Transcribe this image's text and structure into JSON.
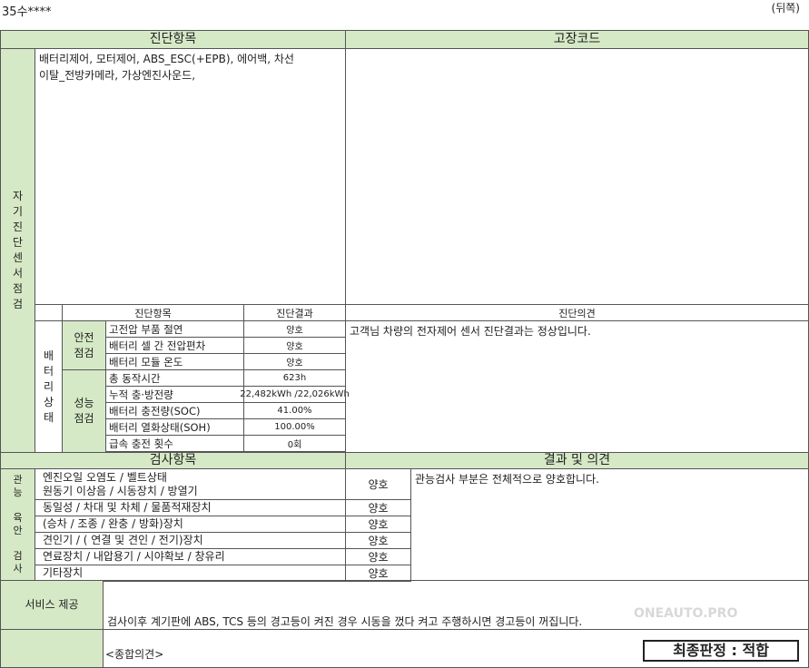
{
  "header": {
    "model": "35수****",
    "page_side": "(뒤쪽)"
  },
  "self_diag": {
    "items_header": "진단항목",
    "codes_header": "고장코드",
    "side_label": "자\n기\n진\n단\n센\n서\n점\n검",
    "items_text": "배터리제어, 모터제어, ABS_ESC(+EPB), 에어백, 차선\n이탈_전방카메라, 가상엔진사운드,",
    "codes_text": ""
  },
  "battery": {
    "side_label": "배\n터\n리\n상\n태",
    "col_item": "진단항목",
    "col_result": "진단결과",
    "col_opinion": "진단의견",
    "opinion": "고객님 차량의 전자제어 센서 진단결과는 정상입니다.",
    "safety_group": "안전\n점검",
    "performance_group": "성능\n점검",
    "rows": [
      {
        "label": "고전압 부품 절연",
        "value": "양호"
      },
      {
        "label": "배터리 셀 간 전압편차",
        "value": "양호"
      },
      {
        "label": "배터리 모듈 온도",
        "value": "양호"
      },
      {
        "label": "총 동작시간",
        "value": "623h"
      },
      {
        "label": "누적 충·방전량",
        "value": "22,482kWh /22,026kWh"
      },
      {
        "label": "배터리 충전량(SOC)",
        "value": "41.00%"
      },
      {
        "label": "배터리 열화상태(SOH)",
        "value": "100.00%"
      },
      {
        "label": "급속 충전 횟수",
        "value": "0회"
      }
    ]
  },
  "inspection": {
    "items_header": "검사항목",
    "result_header": "결과 및 의견",
    "side_label": "관\n능\n\n육\n안\n\n검\n사",
    "opinion": "관능검사 부분은 전체적으로 양호합니다.",
    "rows": [
      {
        "label": "엔진오일 오염도 /  벨트상태\n원동기 이상음 / 시동장치 /  방열기",
        "value": "양호"
      },
      {
        "label": "동일성 /  차대 및 차체 /  물품적재장치",
        "value": "양호"
      },
      {
        "label": "(승차 /  조종 /  완충 /  방화)장치",
        "value": "양호"
      },
      {
        "label": "견인기 / ( 연결 및 견인 /  전기)장치",
        "value": "양호"
      },
      {
        "label": "연료장치 /  내압용기 /  시야확보 /  창유리",
        "value": "양호"
      },
      {
        "label": "기타장치",
        "value": "양호"
      }
    ]
  },
  "service": {
    "label": "서비스 제공",
    "text": "검사이후 계기판에 ABS, TCS 등의 경고등이 켜진 경우 시동을 껐다 켜고 주행하시면 경고등이 꺼집니다."
  },
  "summary": {
    "label": "<종합의견>",
    "verdict": "최종판정 : 적합"
  },
  "watermark": {
    "text": "ONEAUTO.PRO"
  },
  "colors": {
    "section_green": "#d6e9c7",
    "border": "#555555"
  }
}
